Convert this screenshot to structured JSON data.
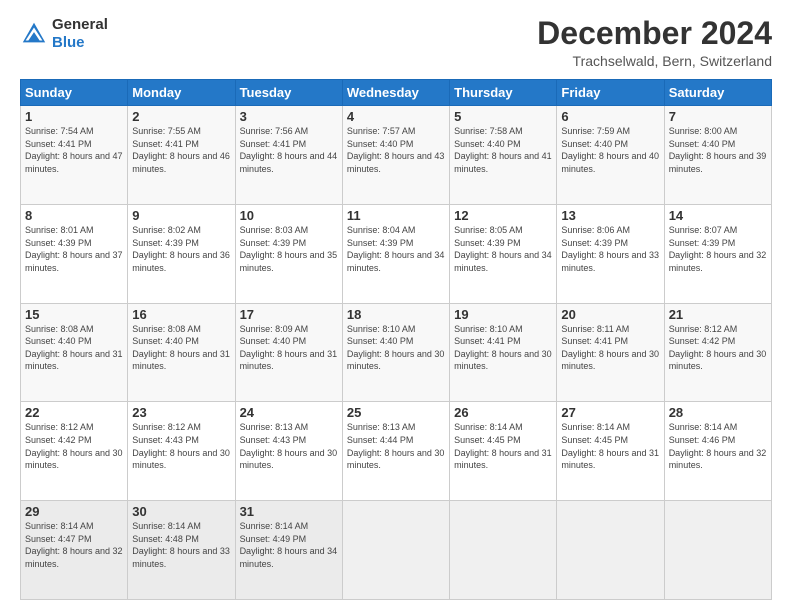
{
  "header": {
    "logo_general": "General",
    "logo_blue": "Blue",
    "month_title": "December 2024",
    "location": "Trachselwald, Bern, Switzerland"
  },
  "days_of_week": [
    "Sunday",
    "Monday",
    "Tuesday",
    "Wednesday",
    "Thursday",
    "Friday",
    "Saturday"
  ],
  "weeks": [
    [
      {
        "day": "1",
        "sunrise": "7:54 AM",
        "sunset": "4:41 PM",
        "daylight": "8 hours and 47 minutes."
      },
      {
        "day": "2",
        "sunrise": "7:55 AM",
        "sunset": "4:41 PM",
        "daylight": "8 hours and 46 minutes."
      },
      {
        "day": "3",
        "sunrise": "7:56 AM",
        "sunset": "4:41 PM",
        "daylight": "8 hours and 44 minutes."
      },
      {
        "day": "4",
        "sunrise": "7:57 AM",
        "sunset": "4:40 PM",
        "daylight": "8 hours and 43 minutes."
      },
      {
        "day": "5",
        "sunrise": "7:58 AM",
        "sunset": "4:40 PM",
        "daylight": "8 hours and 41 minutes."
      },
      {
        "day": "6",
        "sunrise": "7:59 AM",
        "sunset": "4:40 PM",
        "daylight": "8 hours and 40 minutes."
      },
      {
        "day": "7",
        "sunrise": "8:00 AM",
        "sunset": "4:40 PM",
        "daylight": "8 hours and 39 minutes."
      }
    ],
    [
      {
        "day": "8",
        "sunrise": "8:01 AM",
        "sunset": "4:39 PM",
        "daylight": "8 hours and 37 minutes."
      },
      {
        "day": "9",
        "sunrise": "8:02 AM",
        "sunset": "4:39 PM",
        "daylight": "8 hours and 36 minutes."
      },
      {
        "day": "10",
        "sunrise": "8:03 AM",
        "sunset": "4:39 PM",
        "daylight": "8 hours and 35 minutes."
      },
      {
        "day": "11",
        "sunrise": "8:04 AM",
        "sunset": "4:39 PM",
        "daylight": "8 hours and 34 minutes."
      },
      {
        "day": "12",
        "sunrise": "8:05 AM",
        "sunset": "4:39 PM",
        "daylight": "8 hours and 34 minutes."
      },
      {
        "day": "13",
        "sunrise": "8:06 AM",
        "sunset": "4:39 PM",
        "daylight": "8 hours and 33 minutes."
      },
      {
        "day": "14",
        "sunrise": "8:07 AM",
        "sunset": "4:39 PM",
        "daylight": "8 hours and 32 minutes."
      }
    ],
    [
      {
        "day": "15",
        "sunrise": "8:08 AM",
        "sunset": "4:40 PM",
        "daylight": "8 hours and 31 minutes."
      },
      {
        "day": "16",
        "sunrise": "8:08 AM",
        "sunset": "4:40 PM",
        "daylight": "8 hours and 31 minutes."
      },
      {
        "day": "17",
        "sunrise": "8:09 AM",
        "sunset": "4:40 PM",
        "daylight": "8 hours and 31 minutes."
      },
      {
        "day": "18",
        "sunrise": "8:10 AM",
        "sunset": "4:40 PM",
        "daylight": "8 hours and 30 minutes."
      },
      {
        "day": "19",
        "sunrise": "8:10 AM",
        "sunset": "4:41 PM",
        "daylight": "8 hours and 30 minutes."
      },
      {
        "day": "20",
        "sunrise": "8:11 AM",
        "sunset": "4:41 PM",
        "daylight": "8 hours and 30 minutes."
      },
      {
        "day": "21",
        "sunrise": "8:12 AM",
        "sunset": "4:42 PM",
        "daylight": "8 hours and 30 minutes."
      }
    ],
    [
      {
        "day": "22",
        "sunrise": "8:12 AM",
        "sunset": "4:42 PM",
        "daylight": "8 hours and 30 minutes."
      },
      {
        "day": "23",
        "sunrise": "8:12 AM",
        "sunset": "4:43 PM",
        "daylight": "8 hours and 30 minutes."
      },
      {
        "day": "24",
        "sunrise": "8:13 AM",
        "sunset": "4:43 PM",
        "daylight": "8 hours and 30 minutes."
      },
      {
        "day": "25",
        "sunrise": "8:13 AM",
        "sunset": "4:44 PM",
        "daylight": "8 hours and 30 minutes."
      },
      {
        "day": "26",
        "sunrise": "8:14 AM",
        "sunset": "4:45 PM",
        "daylight": "8 hours and 31 minutes."
      },
      {
        "day": "27",
        "sunrise": "8:14 AM",
        "sunset": "4:45 PM",
        "daylight": "8 hours and 31 minutes."
      },
      {
        "day": "28",
        "sunrise": "8:14 AM",
        "sunset": "4:46 PM",
        "daylight": "8 hours and 32 minutes."
      }
    ],
    [
      {
        "day": "29",
        "sunrise": "8:14 AM",
        "sunset": "4:47 PM",
        "daylight": "8 hours and 32 minutes."
      },
      {
        "day": "30",
        "sunrise": "8:14 AM",
        "sunset": "4:48 PM",
        "daylight": "8 hours and 33 minutes."
      },
      {
        "day": "31",
        "sunrise": "8:14 AM",
        "sunset": "4:49 PM",
        "daylight": "8 hours and 34 minutes."
      },
      null,
      null,
      null,
      null
    ]
  ],
  "labels": {
    "sunrise": "Sunrise:",
    "sunset": "Sunset:",
    "daylight": "Daylight:"
  }
}
